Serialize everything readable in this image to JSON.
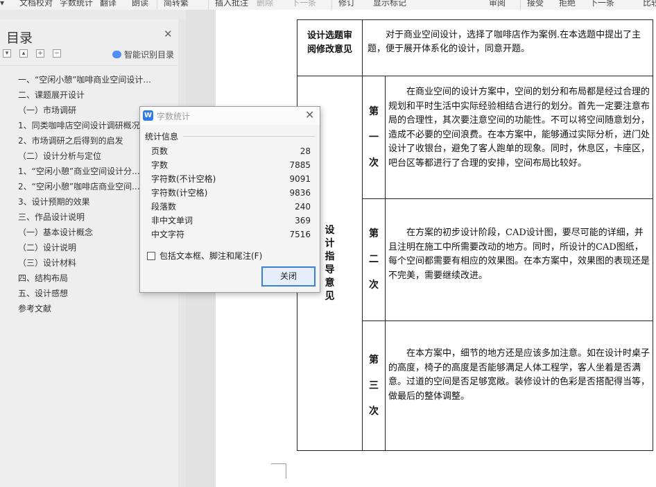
{
  "toolbar": {
    "items": [
      "文档校对",
      "字数统计",
      "翻译",
      "朗读",
      "简转繁",
      "插入批注",
      "删除",
      "下一条",
      "修订",
      "显示标记",
      "审阅",
      "接受",
      "拒绝",
      "下一条",
      "比较"
    ]
  },
  "toc": {
    "title": "目录",
    "smart_recognize": "智能识别目录",
    "items": [
      "一、“空闲小憩”咖啡商业空间设计...",
      "二、课题展开设计",
      "（一）市场调研",
      "1、同类咖啡店空间设计调研概况",
      "2、市场调研之后得到的启发",
      "（二）设计分析与定位",
      "1、“空闲小憩”商业空间设计分...",
      "2、“空闲小憩”咖啡店商业空间...",
      "3、设计预期的效果",
      "三、作品设计说明",
      "（一）基本设计概念",
      "（二）设计说明",
      "（三）设计材料",
      "四、结构布局",
      "五、设计感想",
      "参考文献"
    ]
  },
  "document": {
    "review_label": "设计选题审阅修改意见",
    "review_text": "对于商业空间设计，选择了咖啡店作为案例.在本选题中提出了主题，便于展开体系化的设计，同意开题。",
    "guide_label": "设计指导意见",
    "rounds": [
      {
        "label": "第一次",
        "text": "在商业空间的设计方案中，空间的划分和布局都是经过合理的规划和平时生活中实际经验相结合进行的划分。首先一定要注意布局的合理性，其次要注意空间的功能性。不可以将空间随意划分，造成不必要的空间浪费。在本方案中，能够通过实际分析，进门处设计了收银台，避免了客人跑单的现象。同时，休息区，卡座区，吧台区等都进行了合理的安排，空间布局比较好。"
      },
      {
        "label": "第二次",
        "text": "在方案的初步设计阶段，CAD设计图，要尽可能的详细，并且注明在施工中所需要改动的地方。同时，所设计的CAD图纸，每个空间都需要有相应的效果图。在本方案中，效果图的表现还是不完美，需要继续改进。"
      },
      {
        "label": "第三次",
        "text": "在本方案中，细节的地方还是应该多加注意。如在设计时桌子的高度，椅子的高度是否能够满足人体工程学，客人坐着是否满意。过道的空间是否足够宽敞。装修设计的色彩是否搭配得当等，做最后的整体调整。"
      }
    ]
  },
  "dialog": {
    "title": "字数统计",
    "section": "统计信息",
    "stats": [
      {
        "label": "页数",
        "value": "28"
      },
      {
        "label": "字数",
        "value": "7885"
      },
      {
        "label": "字符数(不计空格)",
        "value": "9091"
      },
      {
        "label": "字符数(计空格)",
        "value": "9836"
      },
      {
        "label": "段落数",
        "value": "240"
      },
      {
        "label": "非中文单词",
        "value": "369"
      },
      {
        "label": "中文字符",
        "value": "7516"
      }
    ],
    "checkbox_label": "包括文本框、脚注和尾注(F)",
    "close_button": "关闭"
  }
}
